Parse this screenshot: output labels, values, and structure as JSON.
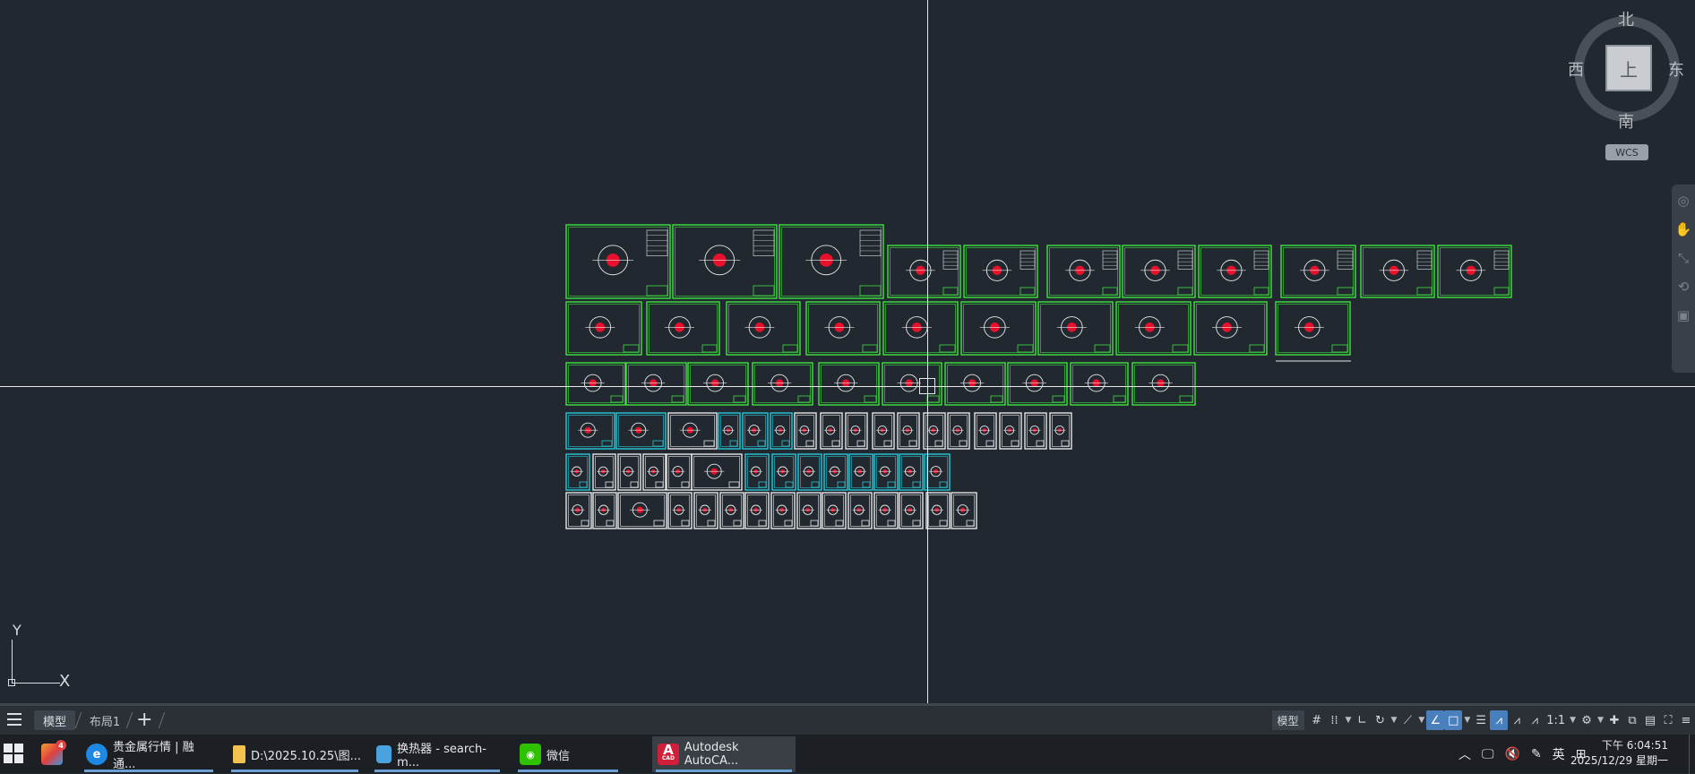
{
  "viewcube": {
    "north": "北",
    "south": "南",
    "west": "西",
    "east": "东",
    "face": "上",
    "wcs": "WCS"
  },
  "ucs": {
    "x_label": "X",
    "y_label": "Y"
  },
  "layout_tabs": {
    "model": "模型",
    "layout1": "布局1",
    "add": "+"
  },
  "status_bar": {
    "model_label": "模型",
    "scale": "1:1"
  },
  "taskbar": {
    "apps": [
      {
        "label": "贵金属行情 | 融通...",
        "icon": "edge-icon"
      },
      {
        "label": "D:\\2025.10.25\\图...",
        "icon": "folder-icon"
      },
      {
        "label": "换热器 - search-m...",
        "icon": "cube-icon"
      },
      {
        "label": "微信",
        "icon": "wechat-icon"
      },
      {
        "label": "Autodesk AutoCA...",
        "icon": "autocad-icon"
      }
    ],
    "autocad_icon_text": "A",
    "autocad_icon_sub": "CAD",
    "badge": "4",
    "ime": "英",
    "time": "下午 6:04:51",
    "date": "2025/12/29 星期一"
  },
  "colors": {
    "canvas": "#212830",
    "sheet_green": "#3fe13f",
    "sheet_cyan": "#27c8d8",
    "sheet_white": "#e6e6e6",
    "detail_red": "#e8102a",
    "accent_blue": "#4a7fbd"
  }
}
